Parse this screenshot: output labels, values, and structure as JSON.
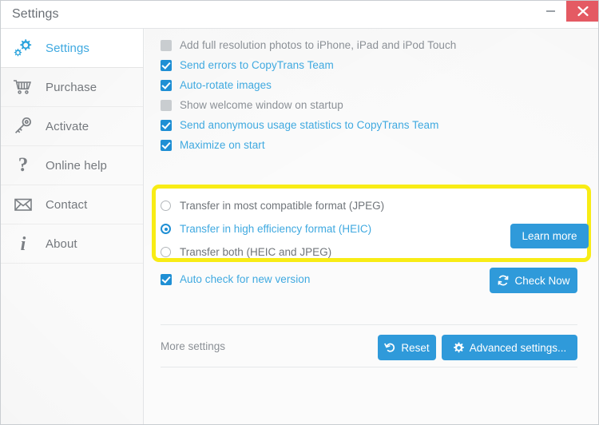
{
  "window": {
    "title": "Settings",
    "minimize_icon": "minimize-icon",
    "close_icon": "close-icon",
    "close_color": "#e45a63"
  },
  "sidebar": {
    "items": [
      {
        "label": "Settings",
        "icon": "gear-icon",
        "active": true
      },
      {
        "label": "Purchase",
        "icon": "cart-icon",
        "active": false
      },
      {
        "label": "Activate",
        "icon": "key-icon",
        "active": false
      },
      {
        "label": "Online help",
        "icon": "question-icon",
        "active": false
      },
      {
        "label": "Contact",
        "icon": "envelope-icon",
        "active": false
      },
      {
        "label": "About",
        "icon": "info-icon",
        "active": false
      }
    ]
  },
  "main": {
    "checkboxes": [
      {
        "label": "Add full resolution photos to iPhone, iPad and iPod Touch",
        "checked": false
      },
      {
        "label": "Send errors to CopyTrans Team",
        "checked": true
      },
      {
        "label": "Auto-rotate images",
        "checked": true
      },
      {
        "label": "Show welcome window on startup",
        "checked": false
      },
      {
        "label": "Send anonymous usage statistics to CopyTrans Team",
        "checked": true
      },
      {
        "label": "Maximize on start",
        "checked": true
      }
    ],
    "transfer_format": {
      "highlight_color": "#f8ec15",
      "options": [
        {
          "label": "Transfer in most compatible format (JPEG)",
          "selected": false
        },
        {
          "label": "Transfer in high efficiency format (HEIC)",
          "selected": true
        },
        {
          "label": "Transfer both (HEIC and JPEG)",
          "selected": false
        }
      ],
      "learn_more_label": "Learn more"
    },
    "auto_check": {
      "label": "Auto check for new version",
      "checked": true
    },
    "check_now_label": "Check Now",
    "check_now_icon": "refresh-icon",
    "more_settings_label": "More settings",
    "reset_label": "Reset",
    "reset_icon": "undo-icon",
    "advanced_label": "Advanced settings...",
    "advanced_icon": "gear-icon"
  },
  "theme": {
    "accent": "#2f9ada",
    "link": "#3fa9e0",
    "muted": "#8b9096"
  }
}
